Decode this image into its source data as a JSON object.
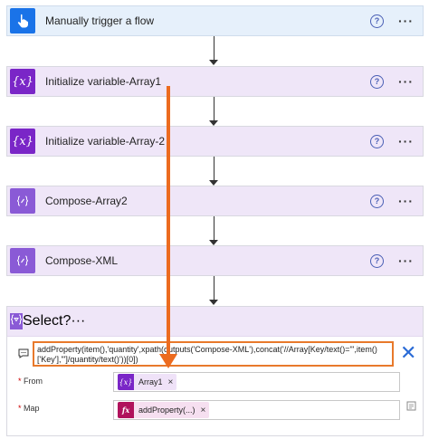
{
  "flow": {
    "steps": [
      {
        "title": "Manually trigger a flow",
        "icon": "hand-pointer-icon"
      },
      {
        "title": "Initialize variable-Array1",
        "icon": "variable-icon"
      },
      {
        "title": "Initialize variable-Array-2",
        "icon": "variable-icon"
      },
      {
        "title": "Compose-Array2",
        "icon": "compose-icon"
      },
      {
        "title": "Compose-XML",
        "icon": "compose-icon"
      }
    ],
    "help_glyph": "?",
    "more_glyph": "···"
  },
  "select": {
    "title": "Select",
    "expression": "addProperty(item(),'quantity',xpath(outputs('Compose-XML'),concat('//Array[Key/text()=\"',item()['Key'],'\"]/quantity/text()'))[0])",
    "from_label": "From",
    "from_token": "Array1",
    "map_label": "Map",
    "map_token": "addProperty(...)",
    "required_mark": "*",
    "remove_glyph": "×",
    "close_glyph": "✕"
  },
  "colors": {
    "trigger_bg": "#e6f0fb",
    "action_bg": "#efe6f8",
    "accent_orange": "#ec6b1f",
    "variable_purple": "#7a26c7"
  }
}
